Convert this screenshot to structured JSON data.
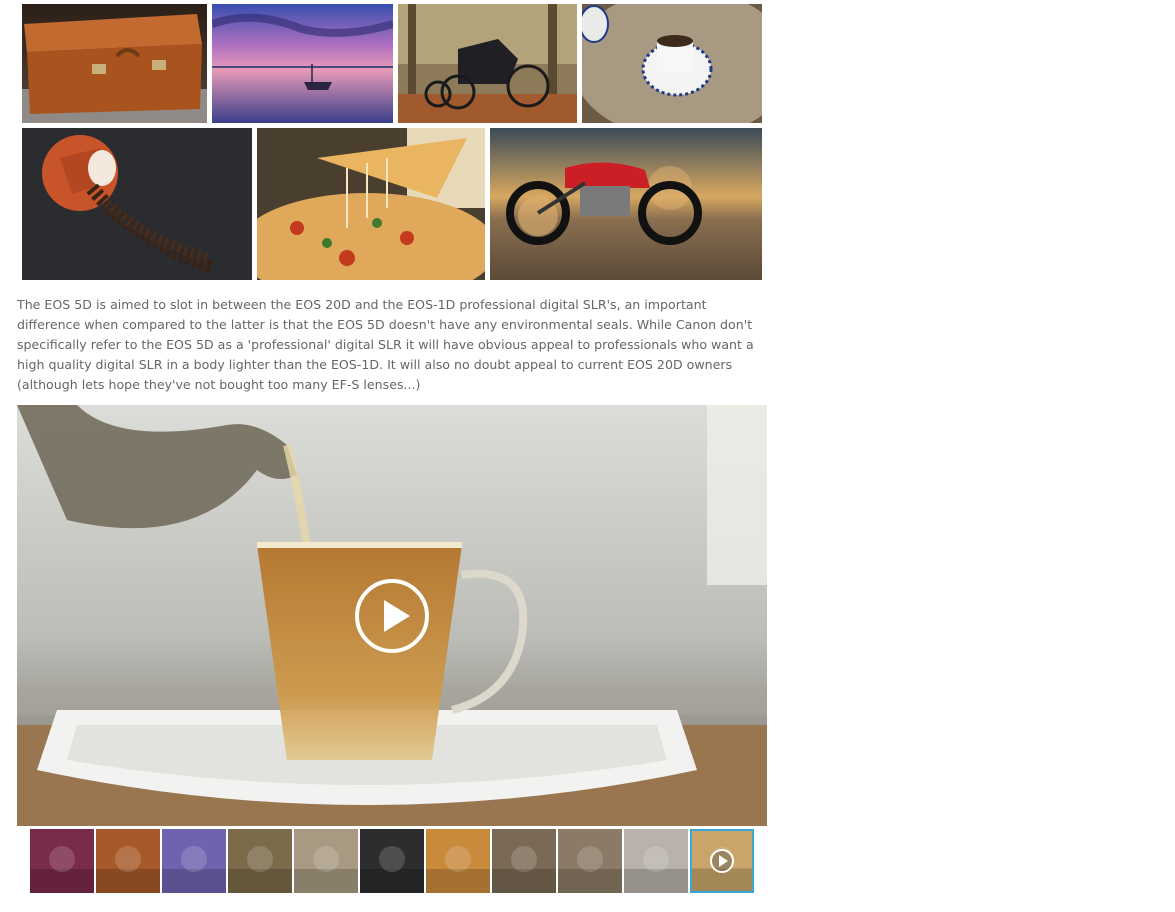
{
  "gallery": {
    "tiles": [
      {
        "subject": "vintage leather suitcase",
        "color": "#a65a2a"
      },
      {
        "subject": "boat on lake at sunset",
        "color": "#6e63b0"
      },
      {
        "subject": "horse carriage in forest",
        "color": "#8a6b4a"
      },
      {
        "subject": "espresso cup on saucer",
        "color": "#a89a82"
      },
      {
        "subject": "spilled coffee beans",
        "color": "#2d2d2f"
      },
      {
        "subject": "pizza slice with cheese",
        "color": "#c98a3c"
      },
      {
        "subject": "motorcycle on beach",
        "color": "#7a6a55"
      }
    ]
  },
  "article": {
    "caption": "The EOS 5D is aimed to slot in between the EOS 20D and the EOS-1D professional digital SLR's, an important difference when compared to the latter is that the EOS 5D doesn't have any environmental seals. While Canon don't specifically refer to the EOS 5D as a 'professional' digital SLR it will have obvious appeal to professionals who want a high quality digital SLR in a body lighter than the EOS-1D. It will also no doubt appeal to current EOS 20D owners (although lets hope they've not bought too many EF-S lenses...)"
  },
  "video": {
    "subject": "tea pouring into glass cup",
    "play_icon": "play-circle-icon"
  },
  "thumbnails": [
    {
      "subject": "tree at sunset",
      "color": "#7a2a4a"
    },
    {
      "subject": "vintage leather suitcase",
      "color": "#a65a2a"
    },
    {
      "subject": "boat on lake at sunset",
      "color": "#6e63b0"
    },
    {
      "subject": "horse carriage in forest",
      "color": "#7b6b4a"
    },
    {
      "subject": "espresso cup on saucer",
      "color": "#a89a82"
    },
    {
      "subject": "spilled coffee beans",
      "color": "#2d2d2f"
    },
    {
      "subject": "pizza slice with cheese",
      "color": "#c98a3c"
    },
    {
      "subject": "motorcycle on beach",
      "color": "#7a6a55"
    },
    {
      "subject": "woman with guitar",
      "color": "#8a7a66"
    },
    {
      "subject": "white sports car",
      "color": "#b8b2aa"
    },
    {
      "subject": "tea video",
      "color": "#c9a56a",
      "active": true,
      "is_video": true
    }
  ],
  "colors": {
    "active_border": "#37a6d8",
    "caption_text": "#666666"
  }
}
